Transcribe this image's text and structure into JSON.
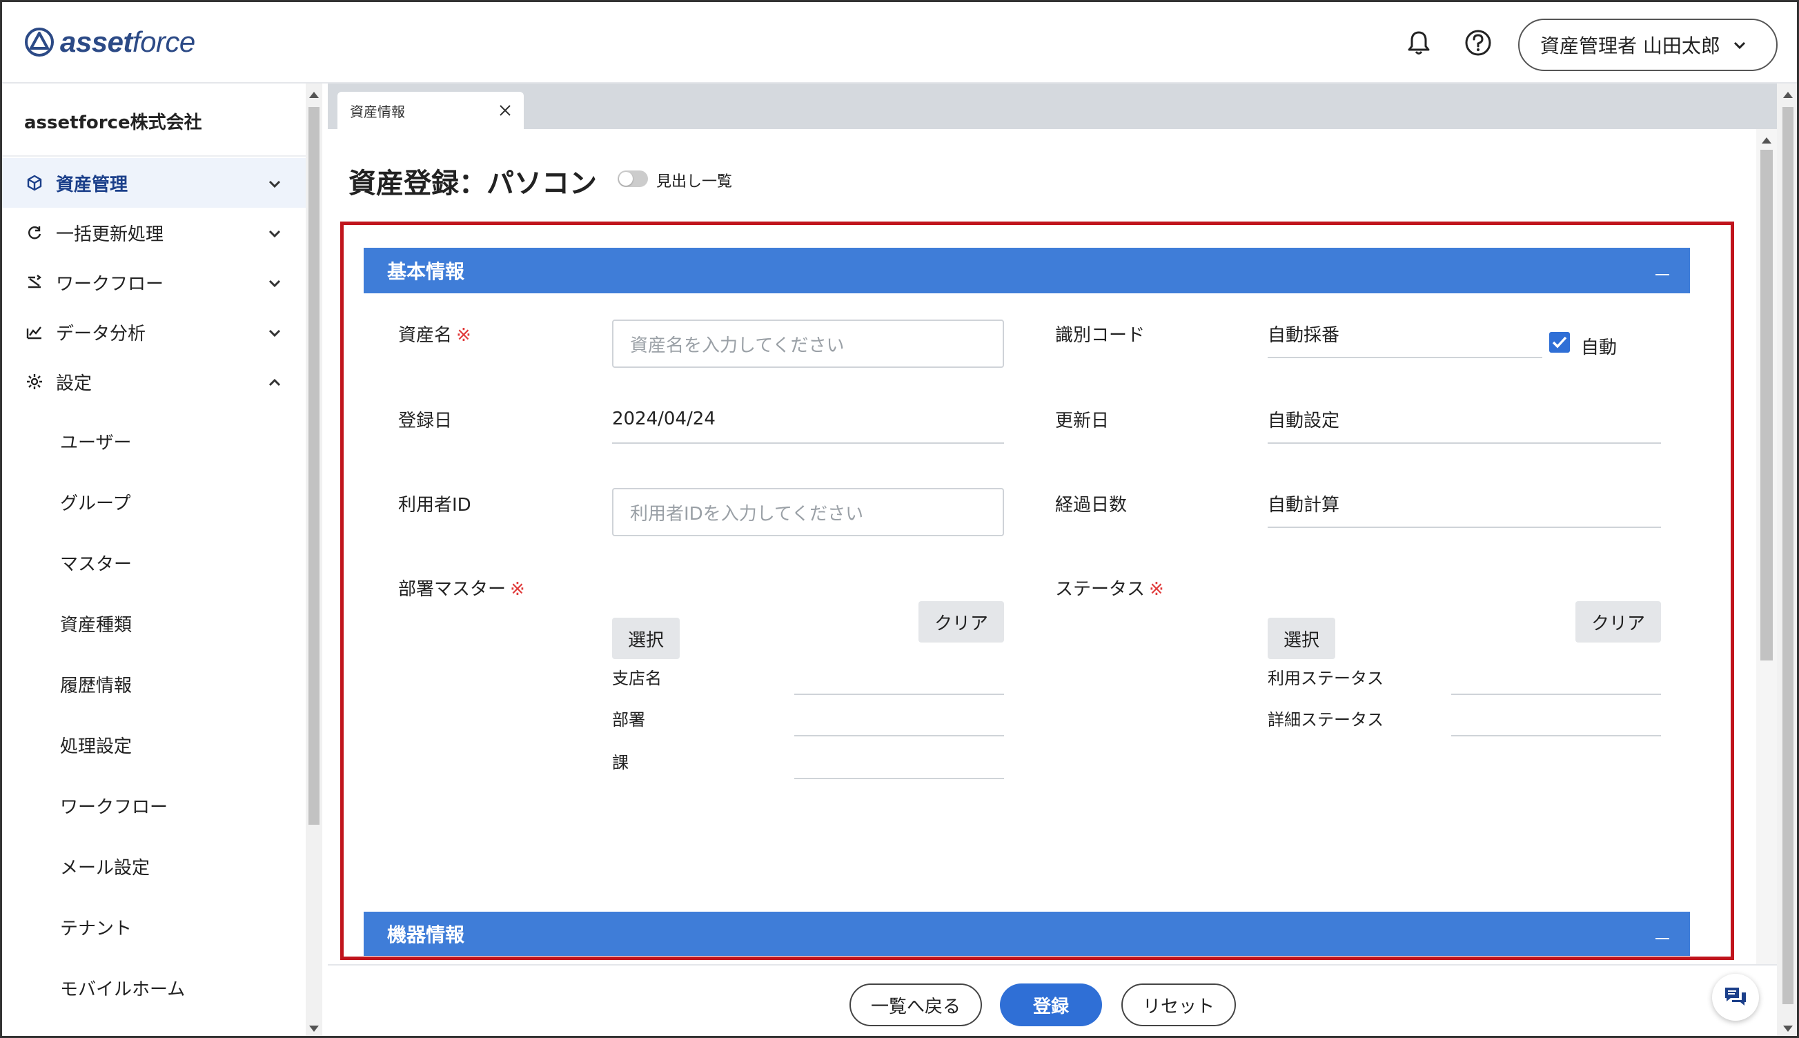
{
  "header": {
    "logo_bold": "asset",
    "logo_light": "force",
    "user_label": "資産管理者 山田太郎"
  },
  "sidebar": {
    "company": "assetforce株式会社",
    "nav": [
      {
        "label": "資産管理",
        "icon": "cube-icon",
        "active": true,
        "expanded": false
      },
      {
        "label": "一括更新処理",
        "icon": "refresh-icon",
        "active": false,
        "expanded": false
      },
      {
        "label": "ワークフロー",
        "icon": "workflow-icon",
        "active": false,
        "expanded": false
      },
      {
        "label": "データ分析",
        "icon": "analytics-icon",
        "active": false,
        "expanded": false
      },
      {
        "label": "設定",
        "icon": "gear-icon",
        "active": false,
        "expanded": true
      }
    ],
    "settings_items": [
      "ユーザー",
      "グループ",
      "マスター",
      "資産種類",
      "履歴情報",
      "処理設定",
      "ワークフロー",
      "メール設定",
      "テナント",
      "モバイルホーム"
    ]
  },
  "tab": {
    "label": "資産情報"
  },
  "page": {
    "title": "資産登録：パソコン",
    "toggle_label": "見出し一覧"
  },
  "basic_section": {
    "title": "基本情報",
    "fields": {
      "asset_name_label": "資産名",
      "asset_name_placeholder": "資産名を入力してください",
      "id_code_label": "識別コード",
      "id_code_value": "自動採番",
      "auto_label": "自動",
      "reg_date_label": "登録日",
      "reg_date_value": "2024/04/24",
      "upd_date_label": "更新日",
      "upd_date_value": "自動設定",
      "user_id_label": "利用者ID",
      "user_id_placeholder": "利用者IDを入力してください",
      "elapsed_label": "経過日数",
      "elapsed_value": "自動計算",
      "dept_master_label": "部署マスター",
      "status_label": "ステータス",
      "required_mark": "※",
      "select_label": "選択",
      "clear_label": "クリア",
      "branch_label": "支店名",
      "dept_label": "部署",
      "section_label": "課",
      "use_status_label": "利用ステータス",
      "detail_status_label": "詳細ステータス"
    }
  },
  "device_section": {
    "title": "機器情報"
  },
  "footer": {
    "back_label": "一覧へ戻る",
    "register_label": "登録",
    "reset_label": "リセット"
  },
  "colors": {
    "accent": "#2f6fd6",
    "section_bar": "#3f7dd8",
    "highlight_frame": "#c0141c",
    "required": "#e03a3a"
  }
}
